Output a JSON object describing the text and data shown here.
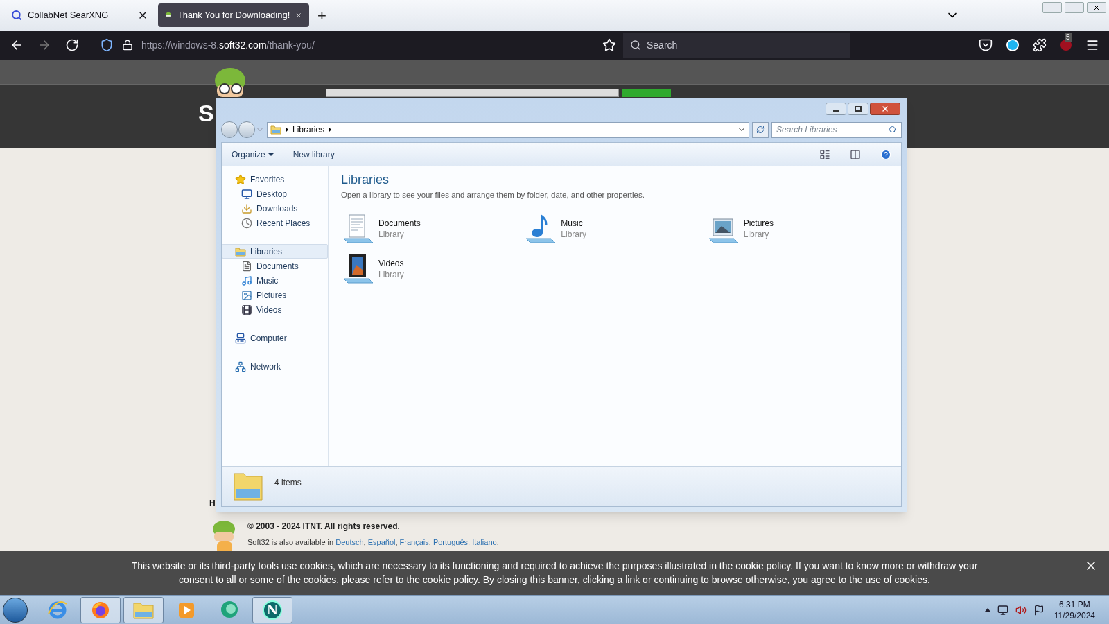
{
  "browser": {
    "tabs": [
      {
        "title": "CollabNet SearXNG",
        "kind": "search",
        "selected": false
      },
      {
        "title": "Thank You for Downloading!",
        "kind": "site",
        "selected": true
      }
    ],
    "new_tab": "+",
    "address": {
      "prefix": "https://windows-8.",
      "domain": "soft32.com",
      "path": "/thank-you/"
    },
    "search_placeholder": "Search",
    "extension_badge": "5"
  },
  "page": {
    "logo_letter": "S",
    "cut_letter": "H",
    "copyright": "© 2003 - 2024 ITNT. All rights reserved.",
    "available_in": "Soft32 is also available in",
    "languages": [
      {
        "label": "Deutsch",
        "separator": ","
      },
      {
        "label": "Español",
        "separator": ","
      },
      {
        "label": "Français",
        "separator": ","
      },
      {
        "label": "Português",
        "separator": ","
      },
      {
        "label": "Italiano",
        "separator": "."
      }
    ]
  },
  "explorer": {
    "breadcrumb": "Libraries",
    "search_placeholder": "Search Libraries",
    "commands": [
      {
        "label": "Organize",
        "dropdown": true
      },
      {
        "label": "New library",
        "dropdown": false
      }
    ],
    "nav": [
      {
        "label": "Favorites",
        "kind": "star",
        "selected": false,
        "children": [
          {
            "label": "Desktop",
            "kind": "desktop",
            "selected": false
          },
          {
            "label": "Downloads",
            "kind": "downloads",
            "selected": false
          },
          {
            "label": "Recent Places",
            "kind": "recent",
            "selected": false
          }
        ]
      },
      {
        "label": "Libraries",
        "kind": "library",
        "selected": true,
        "children": [
          {
            "label": "Documents",
            "kind": "documents",
            "selected": false
          },
          {
            "label": "Music",
            "kind": "music",
            "selected": false
          },
          {
            "label": "Pictures",
            "kind": "pictures",
            "selected": false
          },
          {
            "label": "Videos",
            "kind": "videos",
            "selected": false
          }
        ]
      },
      {
        "label": "Computer",
        "kind": "computer",
        "selected": false
      },
      {
        "label": "Network",
        "kind": "network",
        "selected": false
      }
    ],
    "heading": "Libraries",
    "description": "Open a library to see your files and arrange them by folder, date, and other properties.",
    "items": [
      {
        "name": "Documents",
        "type": "Library",
        "kind": "documents"
      },
      {
        "name": "Music",
        "type": "Library",
        "kind": "music"
      },
      {
        "name": "Pictures",
        "type": "Library",
        "kind": "pictures"
      },
      {
        "name": "Videos",
        "type": "Library",
        "kind": "videos"
      }
    ],
    "status": "4 items"
  },
  "cookie_banner": {
    "text_before": "This website or its third-party tools use cookies, which are necessary to its functioning and required to achieve the purposes illustrated in the cookie policy. If you want to know more or withdraw your consent to all or some of the cookies, please refer to the",
    "link": "cookie policy",
    "text_after": ". By closing this banner, clicking a link or continuing to browse otherwise, you agree to the use of cookies."
  },
  "taskbar": {
    "apps": [
      {
        "kind": "ie",
        "running": false
      },
      {
        "kind": "firefox",
        "running": true
      },
      {
        "kind": "explorer",
        "running": true
      },
      {
        "kind": "media",
        "running": false
      },
      {
        "kind": "chat",
        "running": false
      },
      {
        "kind": "netscape",
        "running": true,
        "logo_text": "N"
      }
    ],
    "time": "6:31 PM",
    "date": "11/29/2024"
  }
}
